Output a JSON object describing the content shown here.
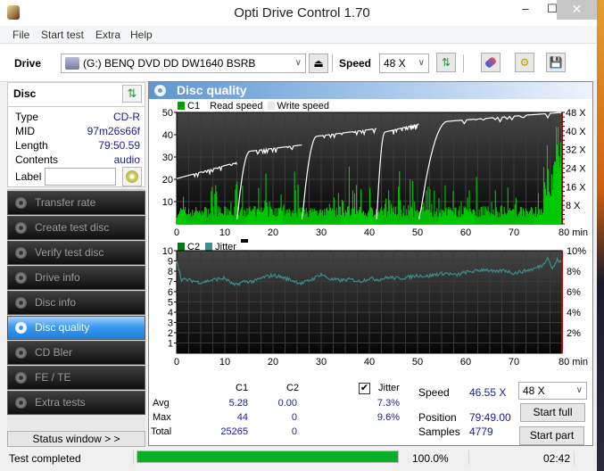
{
  "window": {
    "title": "Opti Drive Control 1.70",
    "minimize": "–",
    "maximize": "☐",
    "close": "✕"
  },
  "menu": [
    "File",
    "Start test",
    "Extra",
    "Help"
  ],
  "toolbar": {
    "drive_label": "Drive",
    "drive_value": "(G:)   BENQ DVD DD DW1640 BSRB",
    "speed_label": "Speed",
    "speed_value": "48 X",
    "icons": [
      "eject-icon",
      "refresh-icon",
      "erase-icon",
      "settings-icon",
      "save-icon"
    ]
  },
  "disc": {
    "header": "Disc",
    "rows": [
      {
        "key": "Type",
        "value": "CD-R"
      },
      {
        "key": "MID",
        "value": "97m26s66f"
      },
      {
        "key": "Length",
        "value": "79:50.59"
      },
      {
        "key": "Contents",
        "value": "audio"
      }
    ],
    "label_key": "Label",
    "label_value": ""
  },
  "nav": [
    {
      "label": "Transfer rate",
      "active": false
    },
    {
      "label": "Create test disc",
      "active": false
    },
    {
      "label": "Verify test disc",
      "active": false
    },
    {
      "label": "Drive info",
      "active": false
    },
    {
      "label": "Disc info",
      "active": false
    },
    {
      "label": "Disc quality",
      "active": true
    },
    {
      "label": "CD Bler",
      "active": false
    },
    {
      "label": "FE / TE",
      "active": false
    },
    {
      "label": "Extra tests",
      "active": false
    }
  ],
  "status_window_button": "Status window > >",
  "panel": {
    "title": "Disc quality"
  },
  "colors": {
    "c1": "#00c800",
    "c2": "#007a10",
    "jitter": "#3f8c8c",
    "read_speed": "#ffffff",
    "end_marker": "#cc0000",
    "progress": "#06b025"
  },
  "chart_data": [
    {
      "type": "bar",
      "title": "C1 / Read speed",
      "legend": [
        "C1",
        "Read speed",
        "Write speed"
      ],
      "xlabel": "min",
      "x_ticks": [
        "0",
        "10",
        "20",
        "30",
        "40",
        "50",
        "60",
        "70",
        "80 min"
      ],
      "xlim": [
        0,
        80
      ],
      "y_ticks_left": [
        "50",
        "40",
        "30",
        "20",
        "10"
      ],
      "ylim_left": [
        0,
        50
      ],
      "y_ticks_right": [
        "48 X",
        "40 X",
        "32 X",
        "24 X",
        "16 X",
        "8 X"
      ],
      "ylim_right": [
        0,
        48
      ],
      "c1_avg": 5.28,
      "c1_max": 44,
      "read_speed_segments": [
        {
          "x": [
            0,
            12.5
          ],
          "y": [
            19.5,
            26.5
          ]
        },
        {
          "x": [
            12.5,
            26
          ],
          "y": [
            0,
            34
          ]
        },
        {
          "x": [
            26,
            41.5
          ],
          "y": [
            0,
            41
          ]
        },
        {
          "x": [
            41.5,
            50.3
          ],
          "y": [
            0,
            43
          ]
        },
        {
          "x": [
            50.3,
            80
          ],
          "y": [
            0,
            48
          ]
        }
      ]
    },
    {
      "type": "line",
      "title": "C2 / Jitter",
      "legend": [
        "C2",
        "Jitter"
      ],
      "xlabel": "min",
      "x_ticks": [
        "0",
        "10",
        "20",
        "30",
        "40",
        "50",
        "60",
        "70",
        "80 min"
      ],
      "xlim": [
        0,
        80
      ],
      "y_ticks_left": [
        "10",
        "9",
        "8",
        "7",
        "6",
        "5",
        "4",
        "3",
        "2",
        "1"
      ],
      "ylim_left": [
        0,
        10
      ],
      "y_ticks_right": [
        "10%",
        "8%",
        "6%",
        "4%",
        "2%"
      ],
      "ylim_right": [
        0,
        10
      ],
      "jitter_points": [
        [
          0,
          9.0
        ],
        [
          1,
          7.2
        ],
        [
          3,
          7.1
        ],
        [
          5,
          6.9
        ],
        [
          8,
          7.2
        ],
        [
          10,
          7.3
        ],
        [
          12,
          6.6
        ],
        [
          14,
          7.0
        ],
        [
          16,
          7.0
        ],
        [
          18,
          7.4
        ],
        [
          20,
          7.6
        ],
        [
          22,
          7.4
        ],
        [
          24,
          7.1
        ],
        [
          26,
          6.8
        ],
        [
          28,
          7.2
        ],
        [
          30,
          7.7
        ],
        [
          32,
          7.2
        ],
        [
          34,
          7.1
        ],
        [
          36,
          7.2
        ],
        [
          38,
          7.0
        ],
        [
          40,
          7.3
        ],
        [
          42,
          7.2
        ],
        [
          44,
          7.4
        ],
        [
          46,
          7.3
        ],
        [
          48,
          7.4
        ],
        [
          50,
          7.6
        ],
        [
          52,
          7.5
        ],
        [
          54,
          7.7
        ],
        [
          56,
          7.8
        ],
        [
          58,
          7.6
        ],
        [
          60,
          7.9
        ],
        [
          62,
          8.0
        ],
        [
          64,
          8.2
        ],
        [
          66,
          7.9
        ],
        [
          68,
          8.1
        ],
        [
          70,
          7.8
        ],
        [
          72,
          8.0
        ],
        [
          74,
          8.2
        ],
        [
          76,
          8.6
        ],
        [
          77,
          9.4
        ],
        [
          78,
          8.2
        ],
        [
          79,
          9.1
        ],
        [
          80,
          8.8
        ]
      ]
    }
  ],
  "stats": {
    "col_c1": "C1",
    "col_c2": "C2",
    "jitter_label": "Jitter",
    "jitter_checked": true,
    "rows": [
      {
        "label": "Avg",
        "c1": "5.28",
        "c2": "0.00",
        "jitter": "7.3%"
      },
      {
        "label": "Max",
        "c1": "44",
        "c2": "0",
        "jitter": "9.6%"
      },
      {
        "label": "Total",
        "c1": "25265",
        "c2": "0",
        "jitter": ""
      }
    ],
    "speed_label": "Speed",
    "speed_value": "46.55 X",
    "position_label": "Position",
    "position_value": "79:49.00",
    "samples_label": "Samples",
    "samples_value": "4779",
    "speed_select": "48 X",
    "start_full": "Start full",
    "start_part": "Start part"
  },
  "statusbar": {
    "text": "Test completed",
    "progress_pct": 100.0,
    "progress_text": "100.0%",
    "time": "02:42"
  }
}
